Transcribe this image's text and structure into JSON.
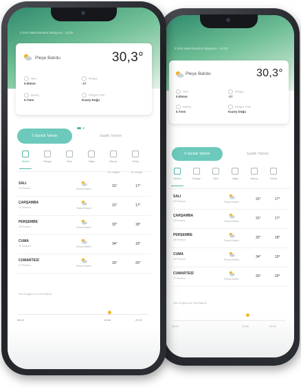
{
  "colors": {
    "accent": "#4fb5a4",
    "accent_light": "#6cc9bb",
    "hero": "#2f8a6c",
    "sun": "#f3b52a",
    "cloud": "#c9d2d6"
  },
  "header_line": "3 Gün Hava Durumu İstasyonu · 14:30",
  "location": "Pleşe Batıdu",
  "temperature": "30,3°",
  "details": [
    {
      "label": "Nem",
      "value": "0.00mm"
    },
    {
      "label": "Rüzgar",
      "value": "-17"
    },
    {
      "label": "Basınç",
      "value": "0.7mm"
    },
    {
      "label": "Rüzgar Yönü",
      "value": "Kuzey Doğu"
    }
  ],
  "segment": {
    "active": "5 Günlük Tahmin",
    "inactive": "Saatlik Tahmin"
  },
  "tabs": [
    "Tahmin",
    "Rüzgar",
    "Nem",
    "Yağış",
    "Basınç",
    "Görüş"
  ],
  "column_headers": {
    "min": "En Yüksek",
    "max": "En Düşük"
  },
  "forecast": [
    {
      "day": "SALI",
      "date": "23 Temmuz",
      "cond": "Parçalı Bulutlu",
      "high": "31°",
      "low": "17°"
    },
    {
      "day": "ÇARŞAMBA",
      "date": "24 Temmuz",
      "cond": "Parçalı Bulutlu",
      "high": "31°",
      "low": "17°"
    },
    {
      "day": "PERŞEMBE",
      "date": "25 Temmuz",
      "cond": "Parçalı Bulutlu",
      "high": "32°",
      "low": "18°"
    },
    {
      "day": "CUMA",
      "date": "26 Temmuz",
      "cond": "Parçalı Bulutlu",
      "high": "34°",
      "low": "19°"
    },
    {
      "day": "CUMARTESİ",
      "date": "27 Temmuz",
      "cond": "Parçalı Bulutlu",
      "high": "33°",
      "low": "20°"
    }
  ],
  "hourly_title": "Gün Doğumu & Gün Batımı",
  "sun_times": {
    "start": "06:12",
    "mid": "13:06",
    "end": "20:21"
  }
}
